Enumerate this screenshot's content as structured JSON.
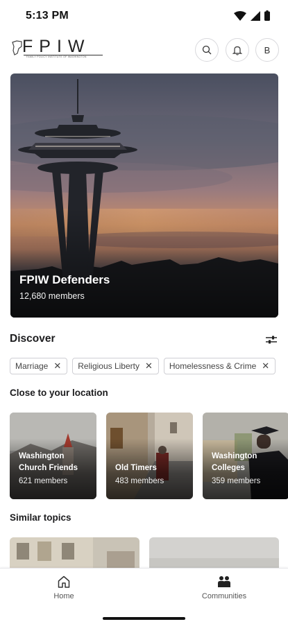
{
  "status_bar": {
    "time": "5:13 PM"
  },
  "header": {
    "logo_text": "FPIW",
    "logo_subtitle": "FAMILY POLICY INSTITUTE OF WASHINGTON",
    "avatar_initial": "B"
  },
  "hero": {
    "title": "FPIW Defenders",
    "members": "12,680 members"
  },
  "discover": {
    "title": "Discover",
    "chips": [
      {
        "label": "Marriage"
      },
      {
        "label": "Religious Liberty"
      },
      {
        "label": "Homelessness & Crime"
      }
    ]
  },
  "close_to_location": {
    "title": "Close to your location",
    "cards": [
      {
        "title": "Washington Church Friends",
        "members": "621 members"
      },
      {
        "title": "Old Timers",
        "members": "483 members"
      },
      {
        "title": "Washington Colleges",
        "members": "359 members"
      }
    ]
  },
  "similar_topics": {
    "title": "Similar topics"
  },
  "bottom_nav": {
    "items": [
      {
        "label": "Home",
        "icon": "home-icon"
      },
      {
        "label": "Communities",
        "icon": "communities-icon"
      }
    ]
  },
  "colors": {
    "accent": "#1c1c1e",
    "chip_border": "#cfcfd4"
  }
}
